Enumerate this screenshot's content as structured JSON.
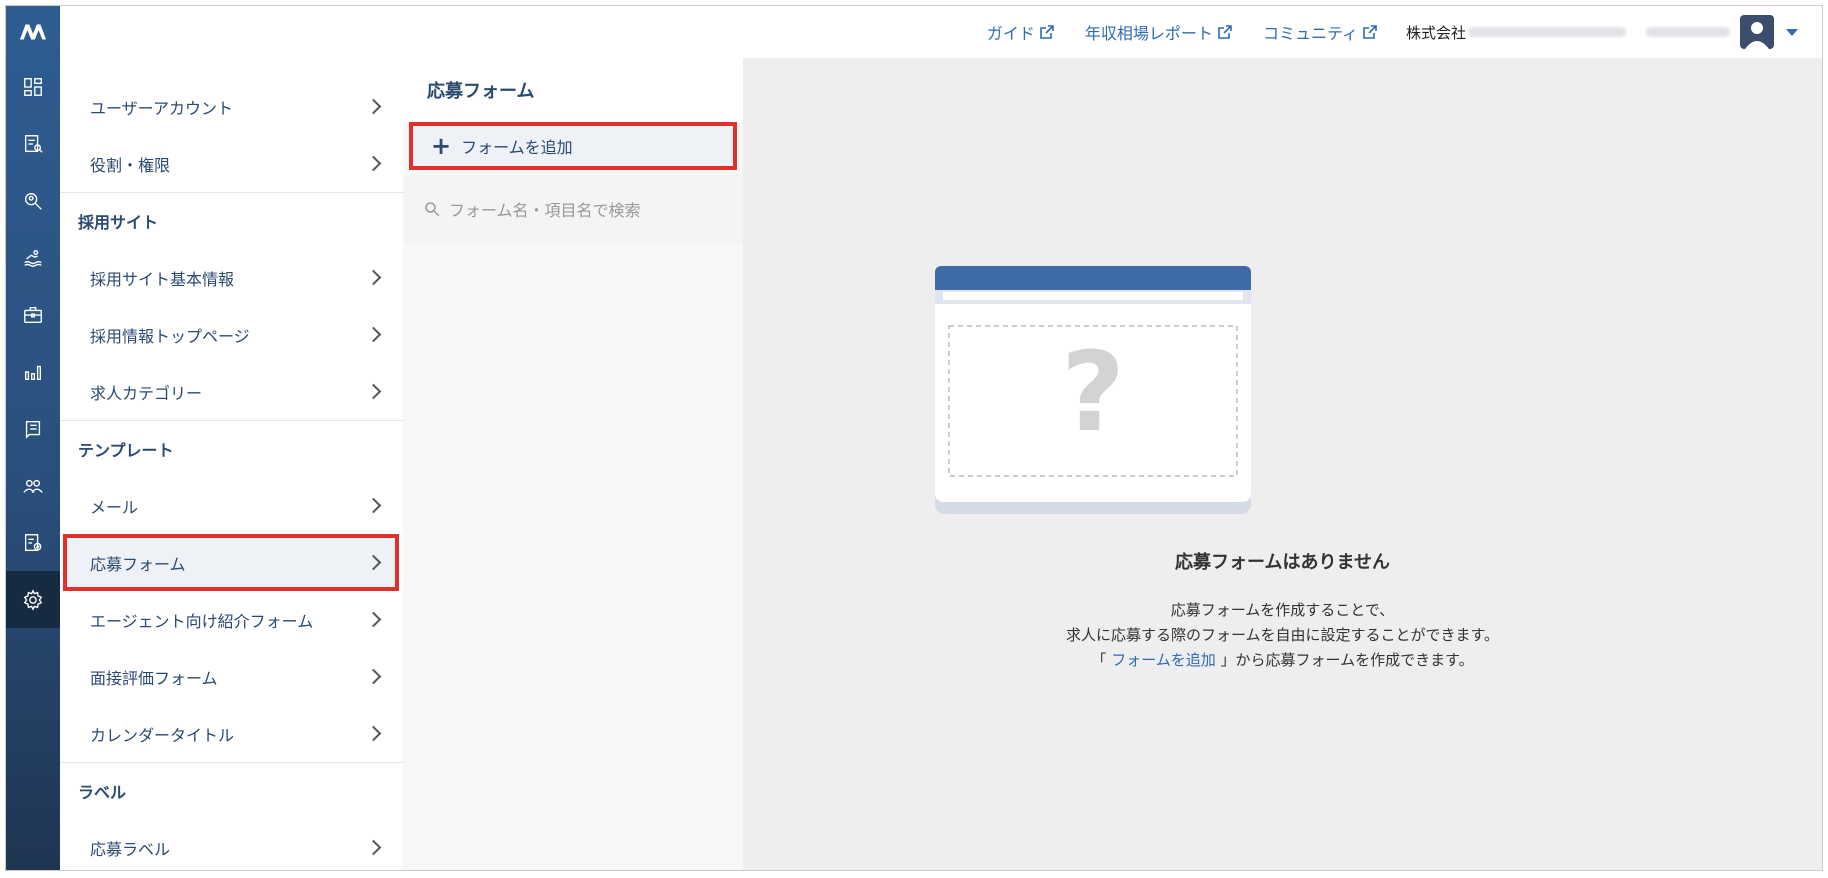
{
  "app": {
    "logo_text": "M"
  },
  "rail": {
    "icons": [
      "dashboard-icon",
      "documents-search-icon",
      "candidate-search-icon",
      "swim-icon",
      "briefcase-icon",
      "chart-icon",
      "book-icon",
      "users-icon",
      "report-icon",
      "settings-icon"
    ]
  },
  "topbar": {
    "links": [
      {
        "label": "ガイド"
      },
      {
        "label": "年収相場レポート"
      },
      {
        "label": "コミュニティ"
      }
    ],
    "company_prefix": "株式会社"
  },
  "menu": {
    "items_top": [
      {
        "label": "ユーザーアカウント"
      },
      {
        "label": "役割・権限"
      }
    ],
    "section_site": "採用サイト",
    "items_site": [
      {
        "label": "採用サイト基本情報"
      },
      {
        "label": "採用情報トップページ"
      },
      {
        "label": "求人カテゴリー"
      }
    ],
    "section_template": "テンプレート",
    "items_template": [
      {
        "label": "メール"
      },
      {
        "label": "応募フォーム"
      },
      {
        "label": "エージェント向け紹介フォーム"
      },
      {
        "label": "面接評価フォーム"
      },
      {
        "label": "カレンダータイトル"
      }
    ],
    "section_label": "ラベル",
    "items_label": [
      {
        "label": "応募ラベル"
      }
    ]
  },
  "list_panel": {
    "title": "応募フォーム",
    "add_button": "フォームを追加",
    "search_placeholder": "フォーム名・項目名で検索"
  },
  "main": {
    "empty_title": "応募フォームはありません",
    "desc_line1": "応募フォームを作成することで、",
    "desc_line2": "求人に応募する際のフォームを自由に設定することができます。",
    "desc_line3_open": "「",
    "desc_line3_link": "フォームを追加",
    "desc_line3_rest": "」から応募フォームを作成できます。",
    "illus_glyph": "?"
  },
  "colors": {
    "accent": "#2f6bb5",
    "highlight": "#e2302a",
    "rail": "#2a4f7c"
  }
}
